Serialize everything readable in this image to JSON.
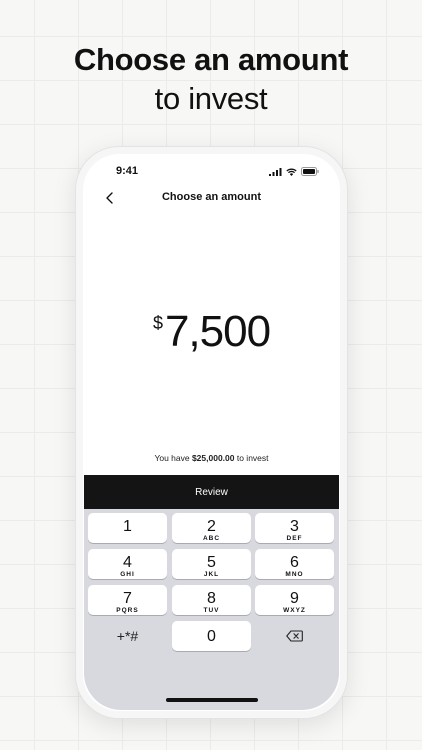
{
  "headline": {
    "line1": "Choose an amount",
    "line2": "to invest"
  },
  "status": {
    "time": "9:41",
    "icons": [
      "signal-icon",
      "wifi-icon",
      "battery-icon"
    ]
  },
  "nav": {
    "title": "Choose an amount",
    "back_icon": "chevron-left-icon"
  },
  "amount": {
    "currency": "$",
    "value": "7,500"
  },
  "balance": {
    "prefix": "You have ",
    "amount": "$25,000.00",
    "suffix": " to invest"
  },
  "review_label": "Review",
  "keypad": {
    "keys": [
      {
        "digit": "1",
        "letters": ""
      },
      {
        "digit": "2",
        "letters": "ABC"
      },
      {
        "digit": "3",
        "letters": "DEF"
      },
      {
        "digit": "4",
        "letters": "GHI"
      },
      {
        "digit": "5",
        "letters": "JKL"
      },
      {
        "digit": "6",
        "letters": "MNO"
      },
      {
        "digit": "7",
        "letters": "PQRS"
      },
      {
        "digit": "8",
        "letters": "TUV"
      },
      {
        "digit": "9",
        "letters": "WXYZ"
      }
    ],
    "symbols": "+*#",
    "zero": "0",
    "delete_icon": "backspace-icon"
  },
  "colors": {
    "button_bg": "#141414",
    "keypad_bg": "#d7d9de",
    "background": "#f7f7f6"
  }
}
